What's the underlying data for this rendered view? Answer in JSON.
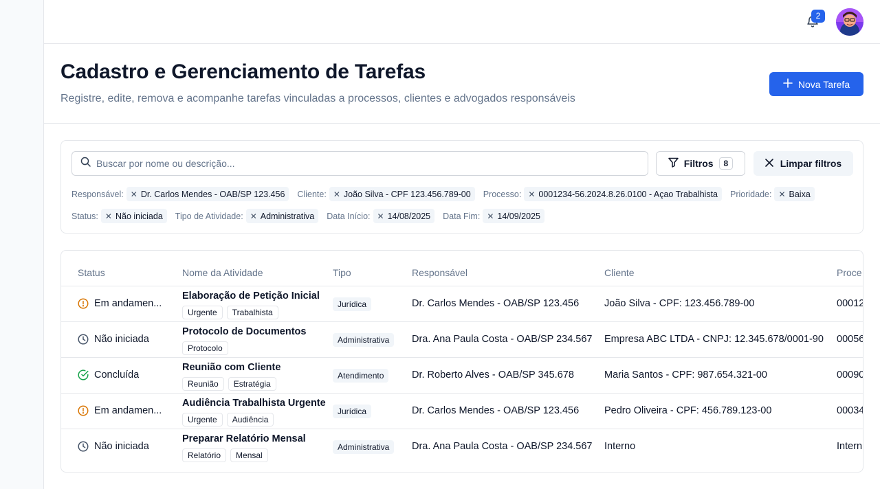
{
  "topbar": {
    "notification_count": "2"
  },
  "header": {
    "title": "Cadastro e Gerenciamento de Tarefas",
    "subtitle": "Registre, edite, remova e acompanhe tarefas vinculadas a processos, clientes e advogados responsáveis",
    "new_button": "Nova Tarefa"
  },
  "filters": {
    "search_placeholder": "Buscar por nome ou descrição...",
    "filters_label": "Filtros",
    "filters_count": "8",
    "clear_label": "Limpar filtros",
    "active": [
      {
        "label": "Responsável:",
        "value": "Dr. Carlos Mendes - OAB/SP 123.456"
      },
      {
        "label": "Cliente:",
        "value": "João Silva - CPF 123.456.789-00"
      },
      {
        "label": "Processo:",
        "value": "0001234-56.2024.8.26.0100 - Açao Trabalhista"
      },
      {
        "label": "Prioridade:",
        "value": "Baixa"
      },
      {
        "label": "Status:",
        "value": "Não iniciada"
      },
      {
        "label": "Tipo de Atividade:",
        "value": "Administrativa"
      },
      {
        "label": "Data Início:",
        "value": "14/08/2025"
      },
      {
        "label": "Data Fim:",
        "value": "14/09/2025"
      }
    ]
  },
  "table": {
    "columns": [
      "Status",
      "Nome da Atividade",
      "Tipo",
      "Responsável",
      "Cliente",
      "Proce"
    ],
    "rows": [
      {
        "status": "Em andamen...",
        "name": "Elaboração de Petição Inicial",
        "tags": [
          "Urgente",
          "Trabalhista"
        ],
        "type": "Jurídica",
        "responsible": "Dr. Carlos Mendes - OAB/SP 123.456",
        "client": "João Silva - CPF: 123.456.789-00",
        "process": "00012"
      },
      {
        "status": "Não iniciada",
        "name": "Protocolo de Documentos",
        "tags": [
          "Protocolo"
        ],
        "type": "Administrativa",
        "responsible": "Dra. Ana Paula Costa - OAB/SP 234.567",
        "client": "Empresa ABC LTDA - CNPJ: 12.345.678/0001-90",
        "process": "00056"
      },
      {
        "status": "Concluída",
        "name": "Reunião com Cliente",
        "tags": [
          "Reunião",
          "Estratégia"
        ],
        "type": "Atendimento",
        "responsible": "Dr. Roberto Alves - OAB/SP 345.678",
        "client": "Maria Santos - CPF: 987.654.321-00",
        "process": "00090"
      },
      {
        "status": "Em andamen...",
        "name": "Audiência Trabalhista Urgente",
        "tags": [
          "Urgente",
          "Audiência"
        ],
        "type": "Jurídica",
        "responsible": "Dr. Carlos Mendes - OAB/SP 123.456",
        "client": "Pedro Oliveira - CPF: 456.789.123-00",
        "process": "00034"
      },
      {
        "status": "Não iniciada",
        "name": "Preparar Relatório Mensal",
        "tags": [
          "Relatório",
          "Mensal"
        ],
        "type": "Administrativa",
        "responsible": "Dra. Ana Paula Costa - OAB/SP 234.567",
        "client": "Interno",
        "process": "Intern"
      }
    ]
  },
  "colors": {
    "accent": "#2563eb",
    "in_progress": "#d97706",
    "not_started": "#475569",
    "done": "#16a34a"
  },
  "icons": {
    "in_progress": "alert-circle-icon",
    "not_started": "clock-icon",
    "done": "check-circle-icon"
  }
}
